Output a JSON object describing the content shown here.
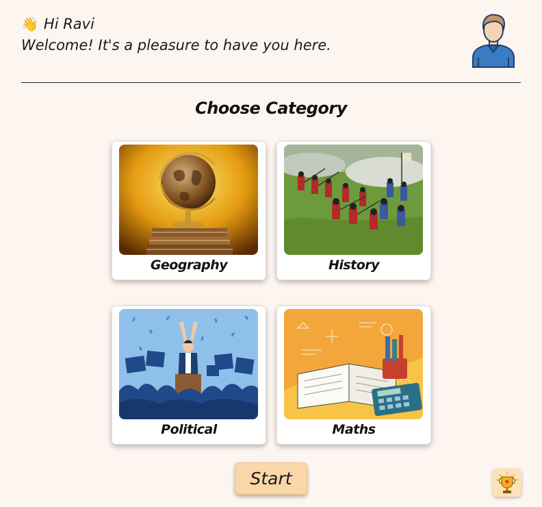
{
  "header": {
    "wave_emoji": "👋",
    "greeting": "Hi Ravi",
    "welcome": "Welcome! It's a pleasure to have you here.",
    "avatar_icon": "user-avatar-icon"
  },
  "page_title": "Choose Category",
  "categories": [
    {
      "label": "Geography",
      "image": "globe-on-books"
    },
    {
      "label": "History",
      "image": "battle-painting"
    },
    {
      "label": "Political",
      "image": "politician-crowd"
    },
    {
      "label": "Maths",
      "image": "book-calculator-pencils"
    }
  ],
  "start_button": "Start",
  "leaderboard_icon": "trophy-icon"
}
